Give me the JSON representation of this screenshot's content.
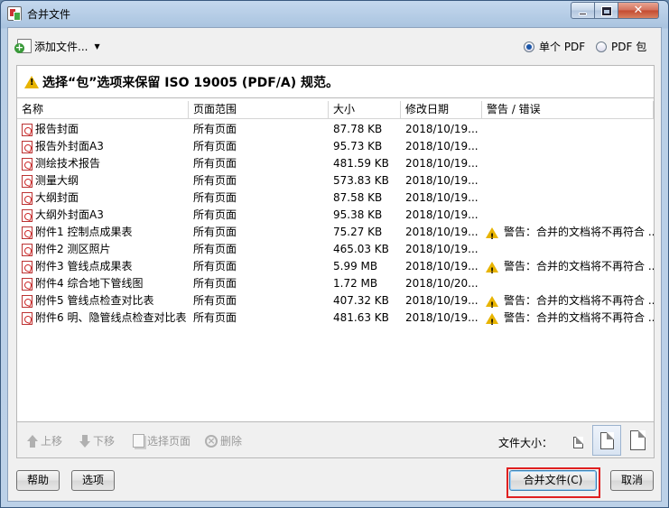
{
  "window": {
    "title": "合并文件"
  },
  "toolbar": {
    "add_files_label": "添加文件...",
    "caret": "▼",
    "radio_single": "单个 PDF",
    "radio_package": "PDF 包"
  },
  "notice": {
    "text": "选择“包”选项来保留 ISO 19005 (PDF/A) 规范。"
  },
  "table": {
    "headers": [
      "名称",
      "页面范围",
      "大小",
      "修改日期",
      "警告 / 错误"
    ],
    "rows": [
      {
        "name": "报告封面",
        "range": "所有页面",
        "size": "87.78 KB",
        "date": "2018/10/19...",
        "warn": ""
      },
      {
        "name": "报告外封面A3",
        "range": "所有页面",
        "size": "95.73 KB",
        "date": "2018/10/19...",
        "warn": ""
      },
      {
        "name": "测绘技术报告",
        "range": "所有页面",
        "size": "481.59 KB",
        "date": "2018/10/19...",
        "warn": ""
      },
      {
        "name": "测量大纲",
        "range": "所有页面",
        "size": "573.83 KB",
        "date": "2018/10/19...",
        "warn": ""
      },
      {
        "name": "大纲封面",
        "range": "所有页面",
        "size": "87.58 KB",
        "date": "2018/10/19...",
        "warn": ""
      },
      {
        "name": "大纲外封面A3",
        "range": "所有页面",
        "size": "95.38 KB",
        "date": "2018/10/19...",
        "warn": ""
      },
      {
        "name": "附件1 控制点成果表",
        "range": "所有页面",
        "size": "75.27 KB",
        "date": "2018/10/19...",
        "warn": "警告：合并的文档将不再符合 ..."
      },
      {
        "name": "附件2 测区照片",
        "range": "所有页面",
        "size": "465.03 KB",
        "date": "2018/10/19...",
        "warn": ""
      },
      {
        "name": "附件3 管线点成果表",
        "range": "所有页面",
        "size": "5.99 MB",
        "date": "2018/10/19...",
        "warn": "警告：合并的文档将不再符合 ..."
      },
      {
        "name": "附件4 综合地下管线图",
        "range": "所有页面",
        "size": "1.72 MB",
        "date": "2018/10/20...",
        "warn": ""
      },
      {
        "name": "附件5 管线点检查对比表",
        "range": "所有页面",
        "size": "407.32 KB",
        "date": "2018/10/19...",
        "warn": "警告：合并的文档将不再符合 ..."
      },
      {
        "name": "附件6 明、隐管线点检查对比表",
        "range": "所有页面",
        "size": "481.63 KB",
        "date": "2018/10/19...",
        "warn": "警告：合并的文档将不再符合 ..."
      }
    ]
  },
  "bottom_tools": {
    "move_up": "上移",
    "move_down": "下移",
    "select_pages": "选择页面",
    "delete": "删除",
    "file_size_label": "文件大小："
  },
  "buttons": {
    "help": "帮助",
    "options": "选项",
    "combine": "合并文件(C)",
    "cancel": "取消"
  },
  "colors": {
    "highlight": "#e02020",
    "warning": "#e8b400",
    "pdf_red": "#c22"
  }
}
